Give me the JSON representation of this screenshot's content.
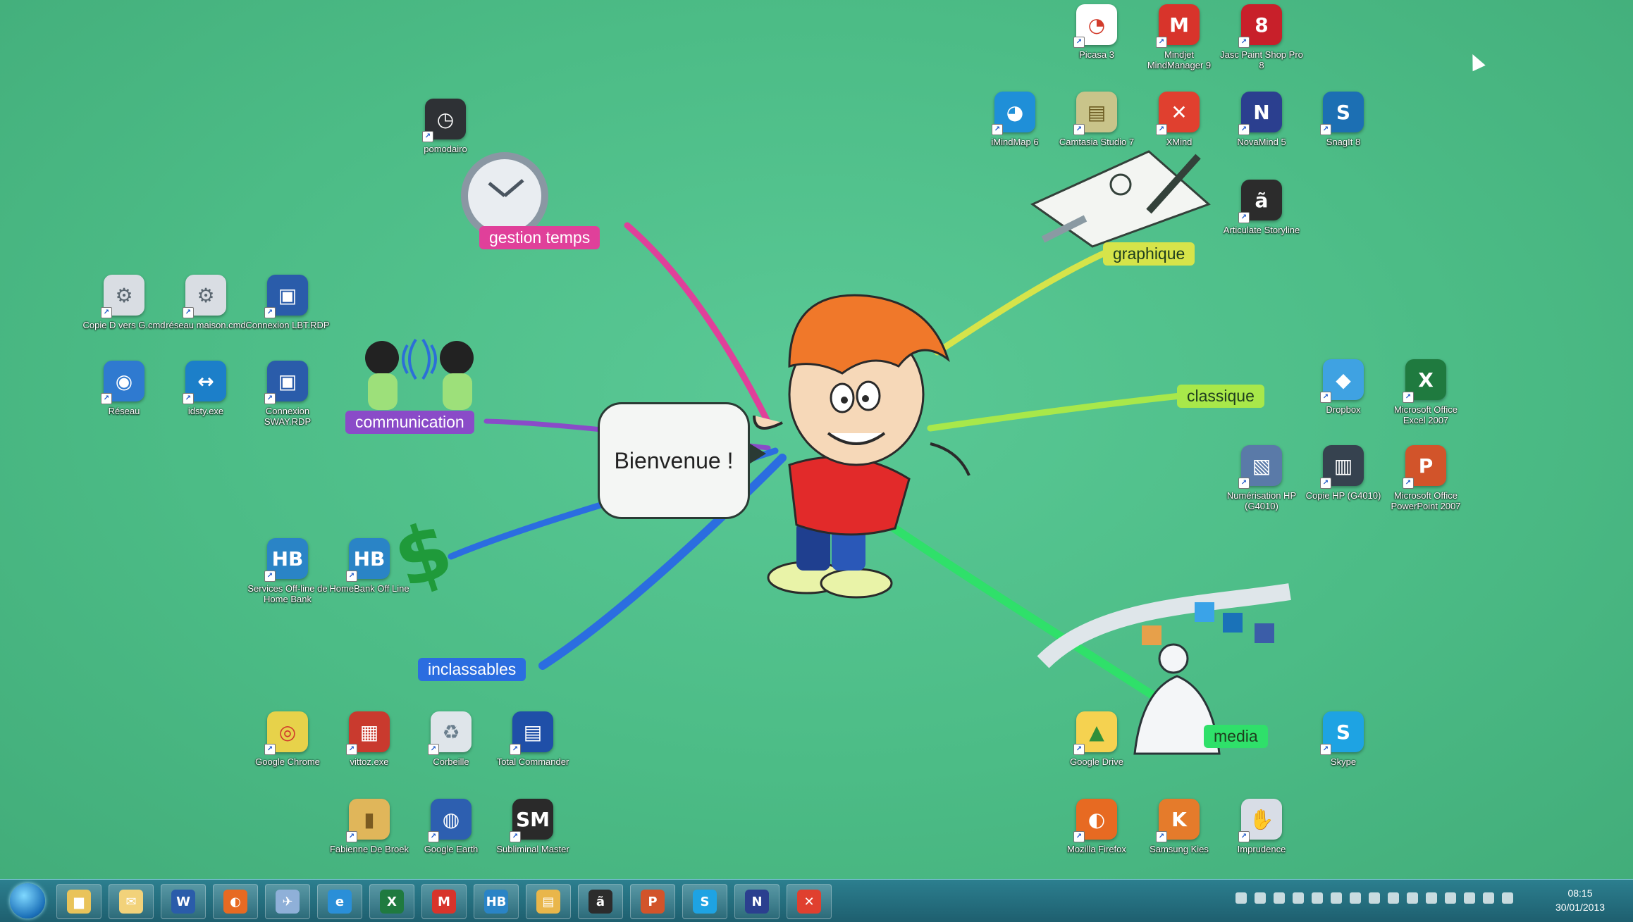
{
  "desktop": {
    "icons": [
      {
        "label": "Picasa 3",
        "glyph": "◔",
        "color": "#ffffff",
        "fg": "#d23b2b"
      },
      {
        "label": "Mindjet MindManager 9",
        "glyph": "M",
        "color": "#d8342b",
        "fg": "#ffffff"
      },
      {
        "label": "Jasc Paint Shop Pro 8",
        "glyph": "8",
        "color": "#c8202a",
        "fg": "#ffffff"
      },
      {
        "label": "iMindMap 6",
        "glyph": "◕",
        "color": "#1f8fd8",
        "fg": "#ffffff"
      },
      {
        "label": "Camtasia Studio 7",
        "glyph": "▤",
        "color": "#c9c48a",
        "fg": "#6a5a20"
      },
      {
        "label": "XMind",
        "glyph": "✕",
        "color": "#e0402f",
        "fg": "#ffffff"
      },
      {
        "label": "NovaMind 5",
        "glyph": "N",
        "color": "#2b3f8f",
        "fg": "#ffffff"
      },
      {
        "label": "SnagIt 8",
        "glyph": "S",
        "color": "#1c6fb3",
        "fg": "#ffffff"
      },
      {
        "label": "Articulate Storyline",
        "glyph": "ã",
        "color": "#2c2c2c",
        "fg": "#ffffff"
      },
      {
        "label": "pomodairo",
        "glyph": "◷",
        "color": "#2e3135",
        "fg": "#ffffff"
      },
      {
        "label": "Copie D vers G.cmd",
        "glyph": "⚙",
        "color": "#d9dde3",
        "fg": "#5a6670"
      },
      {
        "label": "réseau maison.cmd",
        "glyph": "⚙",
        "color": "#d9dde3",
        "fg": "#5a6670"
      },
      {
        "label": "Connexion LBT.RDP",
        "glyph": "▣",
        "color": "#2a5caa",
        "fg": "#ffffff"
      },
      {
        "label": "Réseau",
        "glyph": "◉",
        "color": "#2f7ad0",
        "fg": "#ffffff"
      },
      {
        "label": "idsty.exe",
        "glyph": "↔",
        "color": "#1c7fc9",
        "fg": "#ffffff"
      },
      {
        "label": "Connexion SWAY.RDP",
        "glyph": "▣",
        "color": "#2a5caa",
        "fg": "#ffffff"
      },
      {
        "label": "Services Off-line de Home Bank",
        "glyph": "HB",
        "color": "#2a84c6",
        "fg": "#ffffff"
      },
      {
        "label": "HomeBank Off Line",
        "glyph": "HB",
        "color": "#2a84c6",
        "fg": "#ffffff"
      },
      {
        "label": "Dropbox",
        "glyph": "◆",
        "color": "#3fa2e2",
        "fg": "#ffffff"
      },
      {
        "label": "Microsoft Office Excel 2007",
        "glyph": "X",
        "color": "#1f7a3f",
        "fg": "#ffffff"
      },
      {
        "label": "Numérisation HP (G4010)",
        "glyph": "▧",
        "color": "#5a7aa8",
        "fg": "#ffffff"
      },
      {
        "label": "Copie HP (G4010)",
        "glyph": "▥",
        "color": "#36424f",
        "fg": "#ffffff"
      },
      {
        "label": "Microsoft Office PowerPoint 2007",
        "glyph": "P",
        "color": "#d2542a",
        "fg": "#ffffff"
      },
      {
        "label": "Google Chrome",
        "glyph": "◎",
        "color": "#e7d24a",
        "fg": "#d13b2c"
      },
      {
        "label": "vittoz.exe",
        "glyph": "▦",
        "color": "#c93a2e",
        "fg": "#ffffff"
      },
      {
        "label": "Corbeille",
        "glyph": "♻",
        "color": "#dfe5ea",
        "fg": "#6b7f8e"
      },
      {
        "label": "Total Commander",
        "glyph": "▤",
        "color": "#1f4fa8",
        "fg": "#ffffff"
      },
      {
        "label": "Google Drive",
        "glyph": "▲",
        "color": "#f5d250",
        "fg": "#2f8f3a"
      },
      {
        "label": "Skype",
        "glyph": "S",
        "color": "#1ea3e3",
        "fg": "#ffffff"
      },
      {
        "label": "Fabienne De Broek",
        "glyph": "▮",
        "color": "#e0b65a",
        "fg": "#7a5a20"
      },
      {
        "label": "Google Earth",
        "glyph": "◍",
        "color": "#2d5fb0",
        "fg": "#ffffff"
      },
      {
        "label": "Subliminal Master",
        "glyph": "SM",
        "color": "#2a2a2a",
        "fg": "#ffffff"
      },
      {
        "label": "Mozilla Firefox",
        "glyph": "◐",
        "color": "#e76a22",
        "fg": "#ffffff"
      },
      {
        "label": "Samsung Kies",
        "glyph": "K",
        "color": "#e57b2b",
        "fg": "#ffffff"
      },
      {
        "label": "Imprudence",
        "glyph": "✋",
        "color": "#d8dde6",
        "fg": "#3a3a6a"
      }
    ]
  },
  "mindmap": {
    "center": "Bienvenue !",
    "branches": [
      {
        "label": "gestion temps",
        "color": "#e0409a"
      },
      {
        "label": "communication",
        "color": "#8a4bc8"
      },
      {
        "label": "inclassables",
        "color": "#2b6de0"
      },
      {
        "label": "graphique",
        "color": "#d6e44a"
      },
      {
        "label": "classique",
        "color": "#a8e84a"
      },
      {
        "label": "media",
        "color": "#2fe06a"
      }
    ]
  },
  "taskbar": {
    "start_label": "Démarrer",
    "items": [
      {
        "name": "explorer",
        "glyph": "▆",
        "color": "#e9c35a"
      },
      {
        "name": "outlook",
        "glyph": "✉",
        "color": "#f2d27a"
      },
      {
        "name": "word",
        "glyph": "W",
        "color": "#2a5caa"
      },
      {
        "name": "firefox",
        "glyph": "◐",
        "color": "#e76a22"
      },
      {
        "name": "tool",
        "glyph": "✈",
        "color": "#8fb0d8"
      },
      {
        "name": "ie",
        "glyph": "e",
        "color": "#2a8fd8"
      },
      {
        "name": "excel",
        "glyph": "X",
        "color": "#1f7a3f"
      },
      {
        "name": "mindmanager",
        "glyph": "M",
        "color": "#d8342b"
      },
      {
        "name": "homebank",
        "glyph": "HB",
        "color": "#2a84c6"
      },
      {
        "name": "files",
        "glyph": "▤",
        "color": "#e9b64a"
      },
      {
        "name": "articulate",
        "glyph": "ã",
        "color": "#2c2c2c"
      },
      {
        "name": "powerpoint",
        "glyph": "P",
        "color": "#d2542a"
      },
      {
        "name": "skype",
        "glyph": "S",
        "color": "#1ea3e3"
      },
      {
        "name": "novamind",
        "glyph": "N",
        "color": "#2b3f8f"
      },
      {
        "name": "xmind",
        "glyph": "✕",
        "color": "#e0402f"
      }
    ],
    "clock_time": "08:15",
    "clock_date": "30/01/2013"
  }
}
